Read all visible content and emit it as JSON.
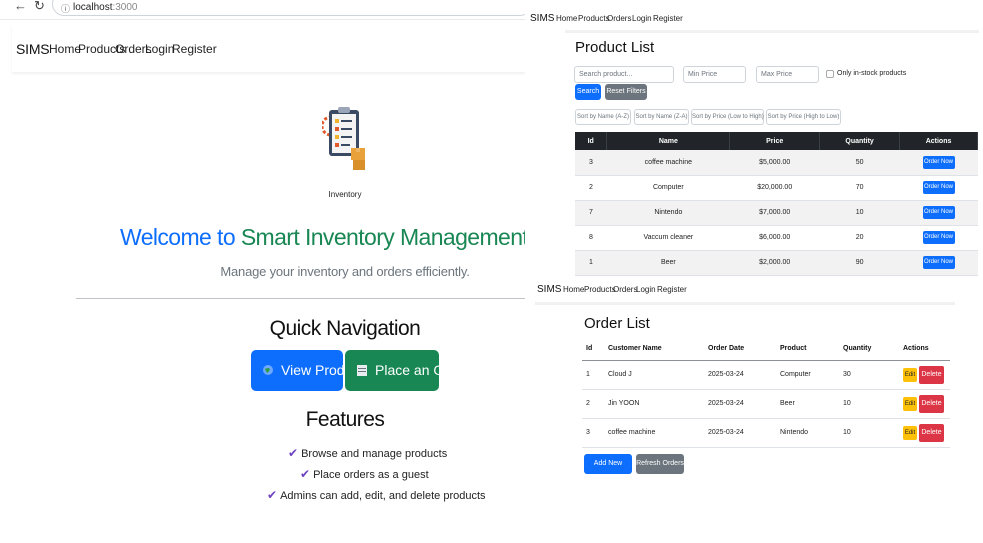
{
  "home": {
    "browser": {
      "back_icon": "arrow-left-icon",
      "reload_icon": "reload-icon",
      "info_icon": "info-icon",
      "url_host": "localhost",
      "url_port": ":3000"
    },
    "nav": {
      "brand": "SIMS",
      "links": [
        "Home",
        "Products",
        "Orders",
        "Login",
        "Register"
      ]
    },
    "logo_caption": "Inventory",
    "welcome_pre": "Welcome to",
    "welcome_post": "Smart Inventory Management System",
    "tagline": "Manage your inventory and orders efficiently.",
    "quick_nav_title": "Quick Navigation",
    "view_products_label": "View Products",
    "place_order_label": "Place an Order",
    "features_title": "Features",
    "features": [
      "Browse and manage products",
      "Place orders as a guest",
      "Admins can add, edit, and delete products"
    ]
  },
  "products_page": {
    "nav": {
      "brand": "SIMS",
      "links": [
        "Home",
        "Products",
        "Orders",
        "Login",
        "Register"
      ]
    },
    "title": "Product List",
    "search_placeholder": "Search product...",
    "min_price_placeholder": "Min Price",
    "max_price_placeholder": "Max Price",
    "in_stock_label": "Only in-stock products",
    "search_label": "Search",
    "reset_label": "Reset Filters",
    "sort_buttons": [
      "Sort by Name (A-Z)",
      "Sort by Name (Z-A)",
      "Sort by Price (Low to High)",
      "Sort by Price (High to Low)"
    ],
    "columns": [
      "Id",
      "Name",
      "Price",
      "Quantity",
      "Actions"
    ],
    "action_label": "Order Now",
    "rows": [
      [
        "3",
        "coffee machine",
        "$5,000.00",
        "50"
      ],
      [
        "2",
        "Computer",
        "$20,000.00",
        "70"
      ],
      [
        "7",
        "Nintendo",
        "$7,000.00",
        "10"
      ],
      [
        "8",
        "Vaccum cleaner",
        "$6,000.00",
        "20"
      ],
      [
        "1",
        "Beer",
        "$2,000.00",
        "90"
      ]
    ]
  },
  "orders_page": {
    "nav": {
      "brand": "SIMS",
      "links": [
        "Home",
        "Products",
        "Orders",
        "Login",
        "Register"
      ]
    },
    "title": "Order List",
    "columns": [
      "Id",
      "Customer Name",
      "Order Date",
      "Product",
      "Quantity",
      "Actions"
    ],
    "edit_label": "Edit",
    "delete_label": "Delete",
    "rows": [
      [
        "1",
        "Cloud J",
        "2025-03-24",
        "Computer",
        "30"
      ],
      [
        "2",
        "Jin YOON",
        "2025-03-24",
        "Beer",
        "10"
      ],
      [
        "3",
        "coffee machine",
        "2025-03-24",
        "Nintendo",
        "10"
      ]
    ],
    "add_label": "Add New Order",
    "refresh_label": "Refresh Orders"
  },
  "colors": {
    "primary": "#0d6efd",
    "success": "#198754",
    "secondary": "#6c757d",
    "warning": "#ffc107",
    "danger": "#dc3545",
    "dark": "#212529",
    "check": "#6f42c1"
  }
}
